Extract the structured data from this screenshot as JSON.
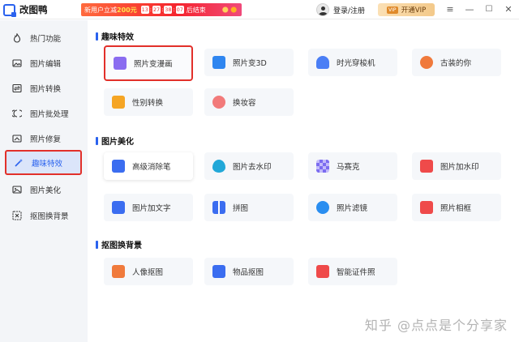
{
  "app": {
    "name": "改图鸭"
  },
  "promo": {
    "text": "新用户立减",
    "amount": "200元",
    "countdown": [
      "13",
      "27",
      "38",
      "07"
    ],
    "end_text": "后结束"
  },
  "user": {
    "login_label": "登录/注册"
  },
  "vip": {
    "badge": "VIP",
    "label": "开通VIP"
  },
  "window": {
    "menu": "≡",
    "minimize": "—",
    "maximize": "☐",
    "close": "✕"
  },
  "sidebar": {
    "items": [
      {
        "label": "热门功能",
        "icon": "flame-icon"
      },
      {
        "label": "图片编辑",
        "icon": "image-edit-icon"
      },
      {
        "label": "图片转换",
        "icon": "convert-icon"
      },
      {
        "label": "图片批处理",
        "icon": "batch-icon"
      },
      {
        "label": "照片修复",
        "icon": "repair-icon"
      },
      {
        "label": "趣味特效",
        "icon": "magic-wand-icon",
        "active": true
      },
      {
        "label": "图片美化",
        "icon": "beautify-icon"
      },
      {
        "label": "抠图换背景",
        "icon": "cutout-icon"
      }
    ]
  },
  "sections": [
    {
      "title": "趣味特效",
      "cards": [
        {
          "label": "照片变漫画",
          "color": "#8a6cf0",
          "highlighted": true
        },
        {
          "label": "照片变3D",
          "color": "#2f86f0"
        },
        {
          "label": "时光穿梭机",
          "color": "#4a7ef5"
        },
        {
          "label": "古装的你",
          "color": "#f07a3c"
        },
        {
          "label": "性别转换",
          "color": "#f5a524"
        },
        {
          "label": "换妆容",
          "color": "#f27a7a"
        }
      ]
    },
    {
      "title": "图片美化",
      "cards": [
        {
          "label": "高级消除笔",
          "color": "#3b6df0"
        },
        {
          "label": "图片去水印",
          "color": "#22a8d8"
        },
        {
          "label": "马赛克",
          "color": "#7b6cf0"
        },
        {
          "label": "图片加水印",
          "color": "#ef4a4a"
        },
        {
          "label": "图片加文字",
          "color": "#3b6df0"
        },
        {
          "label": "拼图",
          "color": "#3b6df0"
        },
        {
          "label": "照片滤镜",
          "color": "#2a8ef0"
        },
        {
          "label": "照片相框",
          "color": "#ef4a4a"
        }
      ]
    },
    {
      "title": "抠图换背景",
      "cards": [
        {
          "label": "人像抠图",
          "color": "#f07a3c"
        },
        {
          "label": "物品抠图",
          "color": "#3b6df0"
        },
        {
          "label": "智能证件照",
          "color": "#ef4a4a"
        }
      ]
    }
  ],
  "watermark": "知乎 @点点是个分享家"
}
